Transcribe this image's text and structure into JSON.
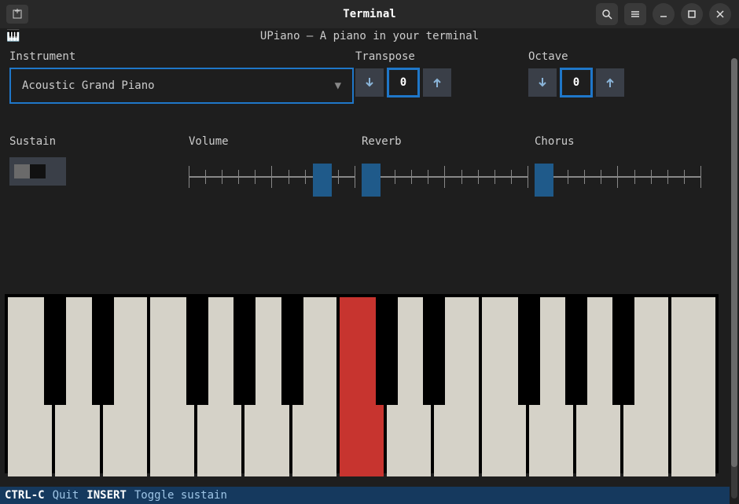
{
  "titlebar": {
    "title": "Terminal"
  },
  "app": {
    "title": "UPiano — A piano in your terminal",
    "instrument": {
      "label": "Instrument",
      "value": "Acoustic Grand Piano"
    },
    "transpose": {
      "label": "Transpose",
      "value": "0"
    },
    "octave": {
      "label": "Octave",
      "value": "0"
    },
    "sustain": {
      "label": "Sustain"
    },
    "volume": {
      "label": "Volume",
      "value": 0.72
    },
    "reverb": {
      "label": "Reverb",
      "value": 0.05
    },
    "chorus": {
      "label": "Chorus",
      "value": 0.05
    }
  },
  "status": {
    "key1": "CTRL-C",
    "act1": "Quit",
    "key2": "INSERT",
    "act2": "Toggle sustain"
  }
}
